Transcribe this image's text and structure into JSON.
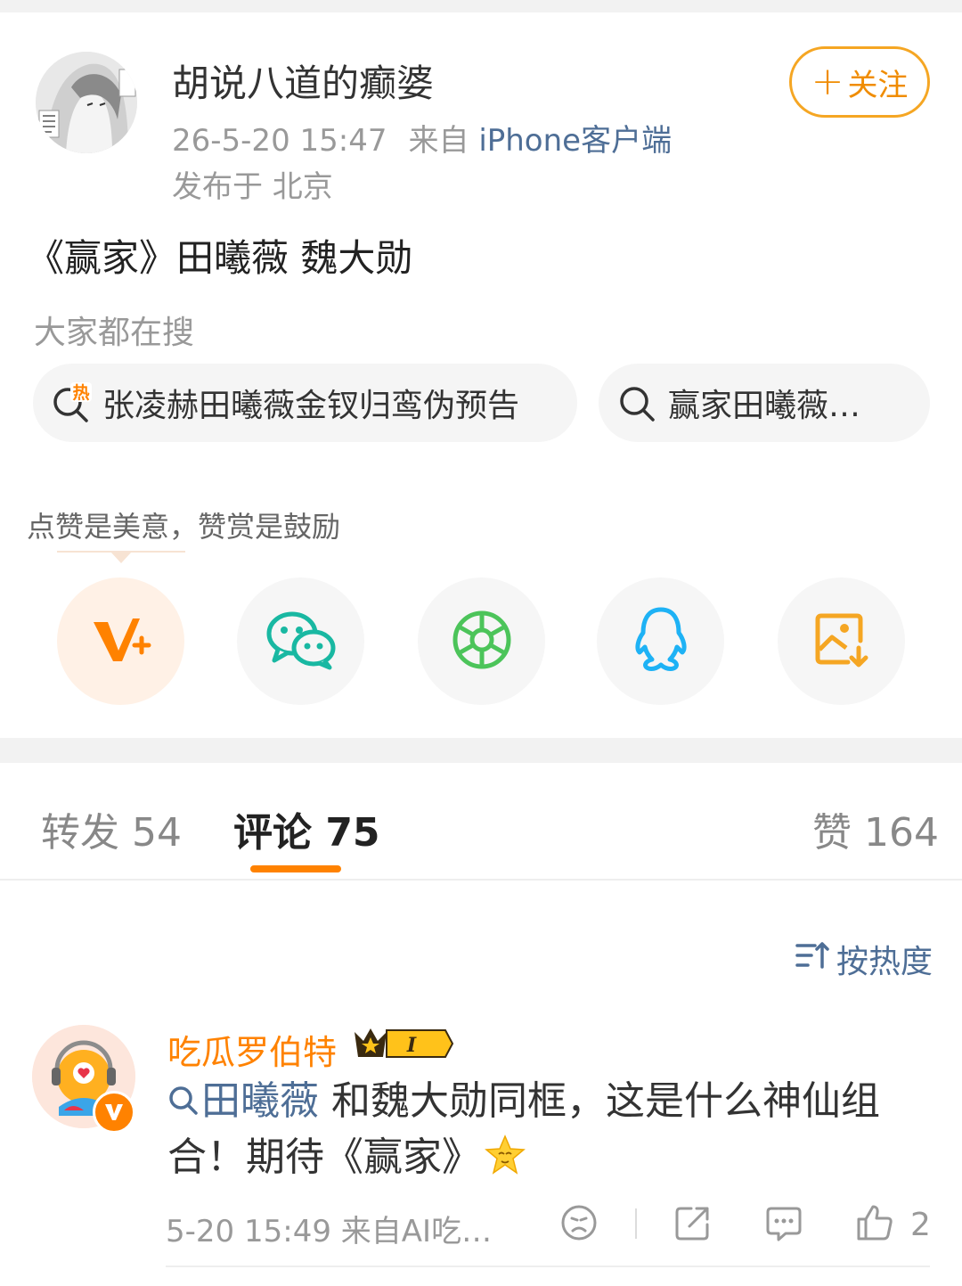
{
  "post": {
    "author_name": "胡说八道的癫婆",
    "timestamp": "26-5-20 15:47",
    "source_prefix": "来自",
    "source_client": "iPhone客户端",
    "location": "发布于 北京",
    "follow_label": "关注",
    "text": "《赢家》田曦薇 魏大勋"
  },
  "search": {
    "heading": "大家都在搜",
    "chips": [
      {
        "icon": "hot-search-icon",
        "badge": "热",
        "text": "张凌赫田曦薇金钗归鸾伪预告"
      },
      {
        "icon": "search-icon",
        "text": "赢家田曦薇…"
      }
    ]
  },
  "share": {
    "tip": "点赞是美意，赞赏是鼓励",
    "buttons": [
      {
        "name": "v-plus-icon",
        "color": "#ff8200"
      },
      {
        "name": "wechat-icon",
        "color": "#19b8a2"
      },
      {
        "name": "moments-icon",
        "color": "#4cc45a"
      },
      {
        "name": "qq-icon",
        "color": "#1eb2f5"
      },
      {
        "name": "save-image-icon",
        "color": "#f5a623"
      }
    ]
  },
  "tabs": {
    "repost": "转发 54",
    "comment": "评论 75",
    "like": "赞 164"
  },
  "sort_label": "按热度",
  "comment": {
    "user_name": "吃瓜罗伯特",
    "level_badge": "I",
    "hashtag": "田曦薇",
    "text": " 和魏大勋同框，这是什么神仙组合！期待《赢家》",
    "time": "5-20 15:49",
    "source": "来自AI吃…",
    "like_count": "2"
  },
  "colors": {
    "accent": "#ff8200",
    "link": "#4e6e96",
    "muted": "#999999"
  }
}
